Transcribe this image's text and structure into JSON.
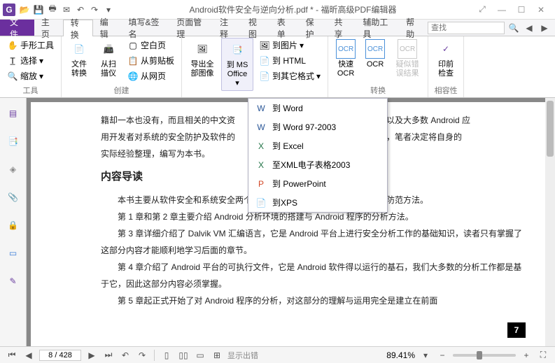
{
  "titlebar": {
    "logo": "G",
    "doc_title": "Android软件安全与逆向分析.pdf * - 福昕高级PDF编辑器"
  },
  "menubar": {
    "file": "文件",
    "tabs": [
      "主页",
      "转换",
      "编辑",
      "填写&签名",
      "页面管理",
      "注释",
      "视图",
      "表单",
      "保护",
      "共享",
      "辅助工具",
      "帮助"
    ],
    "active_index": 1,
    "search_placeholder": "查找"
  },
  "ribbon": {
    "group_tools": {
      "hand": "手形工具",
      "select": "选择",
      "zoom": "缩放",
      "label": "工具"
    },
    "group_create": {
      "file_convert": "文件转换",
      "from_scan": "从扫描仪",
      "blank": "空白页",
      "from_clipboard": "从剪贴板",
      "from_web": "从网页",
      "label": "创建"
    },
    "group_export": {
      "export_all_images": "导出全部图像",
      "to_ms_office": "到 MS Office",
      "to_image": "到图片",
      "to_html": "到 HTML",
      "to_other": "到其它格式",
      "label": ""
    },
    "group_ocr": {
      "quick_ocr": "快速OCR",
      "ocr": "OCR",
      "suspect": "疑似错误结果",
      "label": "转换"
    },
    "group_preflight": {
      "preflight": "印前检查",
      "label": "相容性"
    }
  },
  "dropdown": {
    "items": [
      {
        "label": "到 Word",
        "icon": "word-icon"
      },
      {
        "label": "到 Word 97-2003",
        "icon": "word-icon"
      },
      {
        "label": "到 Excel",
        "icon": "excel-icon"
      },
      {
        "label": "至XML电子表格2003",
        "icon": "excel-icon"
      },
      {
        "label": "到 PowerPoint",
        "icon": "ppt-icon"
      },
      {
        "label": "到XPS",
        "icon": "xps-icon"
      }
    ]
  },
  "document": {
    "p1": "籍却一本也没有，而且相关的中文资",
    "p1b": "通用户以及大多数 Android 应",
    "p2": "用开发者对系统的安全防护及软件的",
    "p2b": "。因此，笔者决定将自身的",
    "p3": "实际经验整理，编写为本书。",
    "h": "内容导读",
    "p4": "本书主要从软件安全和系统安全两个方面讲解 Android 平台存在的攻击与防范方法。",
    "p5": "第 1 章和第 2 章主要介绍 Android 分析环境的搭建与 Android 程序的分析方法。",
    "p6": "第 3 章详细介绍了 Dalvik VM 汇编语言，它是 Android 平台上进行安全分析工作的基础知识，读者只有掌握了这部分内容才能顺利地学习后面的章节。",
    "p7": "第 4 章介绍了 Android 平台的可执行文件，它是 Android 软件得以运行的基石，我们大多数的分析工作都是基于它，因此这部分内容必须掌握。",
    "p8": "第 5 章起正式开始了对 Android 程序的分析，对这部分的理解与运用完全是建立在前面",
    "page_number": "7"
  },
  "statusbar": {
    "page": "8 / 428",
    "error": "显示出错",
    "zoom": "89.41%"
  }
}
